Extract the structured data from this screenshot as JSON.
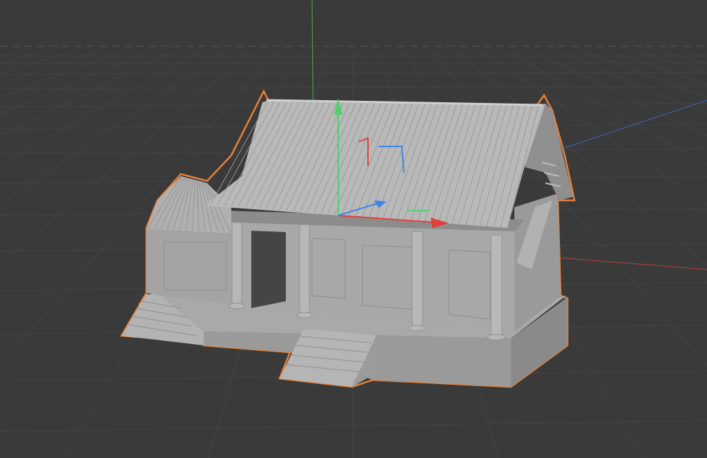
{
  "viewport": {
    "background": "#3a3a3a",
    "grid_color": "#454545",
    "selection_outline": "#e8823a",
    "model_color": "#a7a7a7",
    "axis_colors": {
      "x": "#d9423a",
      "y": "#55c35e",
      "z": "#3b7fe0"
    }
  },
  "scene": {
    "object": "pavilion-model",
    "selected": true,
    "gizmo": "move-gizmo"
  }
}
